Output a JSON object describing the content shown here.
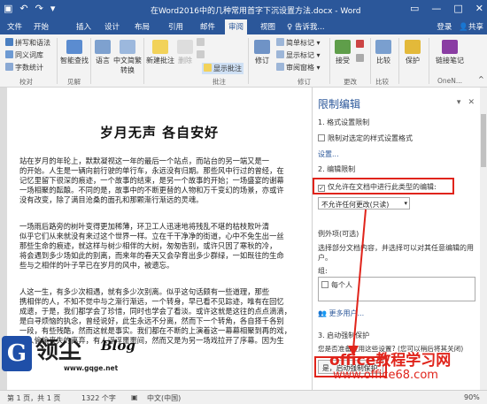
{
  "window": {
    "title": "在Word2016中的几种常用首字下沉设置方法.docx - Word",
    "qat_icons": [
      "save-icon",
      "undo-icon",
      "redo-icon",
      "customize-icon"
    ],
    "controls": [
      "ribbon-display-icon",
      "minimize-icon",
      "maximize-icon",
      "close-icon"
    ]
  },
  "tabs": [
    "文件",
    "开始",
    "插入",
    "设计",
    "布局",
    "引用",
    "邮件",
    "审阅",
    "视图",
    "♀ 告诉我..."
  ],
  "active_tab": "审阅",
  "account": {
    "login": "登录",
    "share": "共享"
  },
  "ribbon": {
    "proofing": {
      "items": [
        "拼写和语法",
        "同义词库",
        "字数统计"
      ],
      "group_label": "校对"
    },
    "insights": {
      "label": "智能查找",
      "group_label": "见解"
    },
    "language": {
      "items": [
        "语言",
        "中文简繁转换"
      ],
      "group_label": ""
    },
    "comments": {
      "items": [
        "新建批注",
        "删除",
        "",
        "",
        "显示批注"
      ],
      "group_label": "批注"
    },
    "tracking": {
      "items": [
        "修订",
        "简单标记",
        "显示标记",
        "审阅窗格"
      ],
      "group_label": "修订"
    },
    "changes": {
      "items": [
        "接受",
        "",
        ""
      ],
      "group_label": "更改"
    },
    "compare": {
      "items": [
        "比较"
      ],
      "group_label": "比较"
    },
    "protect": {
      "items": [
        "保护"
      ],
      "group_label": ""
    },
    "onenote": {
      "items": [
        "链接笔记"
      ],
      "group_label": "OneN..."
    }
  },
  "document": {
    "title": "岁月无声 各自安好",
    "paragraphs": [
      "        站在岁月的年轮上，默默凝视这一年的最后一个站点，而站台的另一端又是一\n的开始。人生是一辆向前行驶的单行车，永远没有归期。那些风中行过的曾经，在\n记忆里留下很深的痕迹，一个故事的结束，是另一个故事的开始；一场盛宴的谢幕\n一场相聚的酝酿。不同的是，故事中的不断更替的人物和万千变幻的场景，亦或许\n没有改变，除了满目沧桑的面孔和那颗渐行渐远的灵魂。",
      "        一场雨后路旁的树叶变得更加稀薄，环卫工人迅速地将残乱不堪的枯枝败叶清\n似乎它们从来就没有来过这个世界一样。立在千干净净的街道，心中不免生出一丝\n那些生命的痕迹，就这样与树少相伴的大树，匆匆告别，或许只因了寒秋的冷，\n将会遇到多少场如此的别离，而来年的春天又会孕育出多少群绿，一如既往的生命\n些与之相伴的叶子早已在岁月的风中，被遗忘。",
      "        人这一生，有多少次相遇，就有多少次别离。似乎这句话颇有一些道理，那些\n携相伴的人，不知不觉中与之渐行渐远，一个转身，早已看不见踪迹，唯有在回忆\n成遗，于是，我们都学会了珍惜，同时也学会了看淡。或许这就是这往的点点滴滴，\n是白寻烦恼的执念，曾经说好，此生永远不分离，然而下一个转角，各自择千各别\n一段，有些残酷，然而这就是事实。我们都在不断的上演着这一幕幕相聚到再的戏，\n有人偷偷丧失的离弃，有人浮浮噩噩间，然而又是为另一场戏拉开了序幕。因为生"
    ]
  },
  "pane": {
    "title": "限制编辑",
    "sections": {
      "format_heading": "1. 格式设置限制",
      "format_checkbox": "限制对选定的样式设置格式",
      "format_link": "设置...",
      "edit_heading": "2. 编辑限制",
      "edit_checkbox": "仅允许在文档中进行此类型的编辑:",
      "edit_checkbox_checked": true,
      "edit_dropdown": "不允许任何更改(只读)",
      "exceptions_heading": "例外项(可选)",
      "exceptions_desc": "选择部分文档内容，并选择可以对其任意编辑的用户。",
      "groups_label": "组:",
      "group_item": "每个人",
      "more_users": "更多用户...",
      "enforce_heading": "3. 启动强制保护",
      "enforce_question": "您是否准备应用这些设置? (您可以稍后将其关闭)",
      "enforce_button": "是，启动强制保护"
    }
  },
  "status": {
    "page": "第 1 页，共 1 页",
    "words": "1322 个字",
    "language": "中文(中国)",
    "zoom": "90%"
  },
  "watermarks": {
    "left_badge": "G",
    "left_name": "领尘",
    "left_blog": "Blog",
    "left_url": "www.gqge.net",
    "right_title": "office教程学习网",
    "right_url": "www.office68.com"
  },
  "colors": {
    "accent": "#2b579a",
    "highlight": "#e0241b"
  }
}
